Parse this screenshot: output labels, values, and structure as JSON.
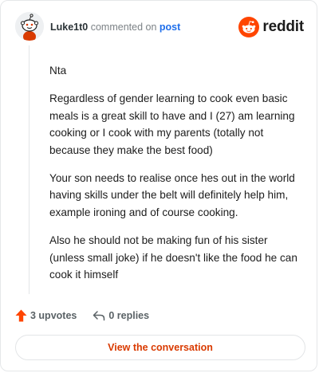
{
  "comment": {
    "author": "Luke1t0",
    "action_text": "commented on",
    "post_link": "post",
    "paragraphs": [
      "Nta",
      "Regardless of gender learning to cook even basic meals is a great skill to have and I (27) am learning cooking or I cook with my parents (totally not because they make the best food)",
      "Your son needs to realise once hes out in the world having skills under the belt will definitely help him, example ironing and of course cooking.",
      "Also he should not be making fun of his sister (unless small joke) if he doesn't like the food he can cook it himself"
    ]
  },
  "brand": {
    "name": "reddit",
    "icon": "reddit-snoo-icon",
    "color": "#ff4500"
  },
  "actions": {
    "upvotes_label": "3 upvotes",
    "upvote_icon": "upvote-arrow-icon",
    "replies_label": "0 replies",
    "reply_icon": "reply-arrow-icon"
  },
  "cta": {
    "label": "View the conversation"
  },
  "colors": {
    "accent": "#d93a00",
    "upvote": "#ff4500",
    "link": "#1f6feb"
  }
}
